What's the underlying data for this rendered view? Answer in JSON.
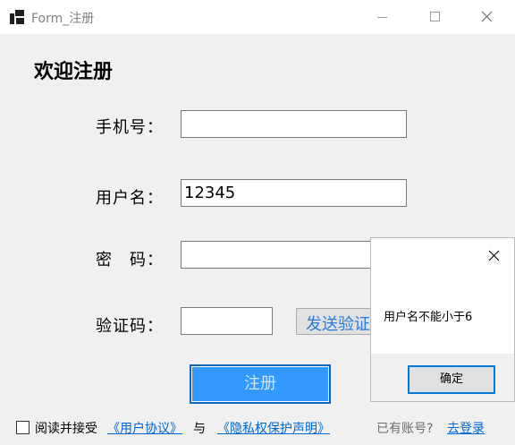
{
  "window": {
    "title": "Form_注册"
  },
  "heading": "欢迎注册",
  "form": {
    "phone_label": "手机号：",
    "phone_value": "",
    "username_label": "用户名：",
    "username_value": "12345",
    "password_label": "密　码：",
    "password_value": "",
    "code_label": "验证码：",
    "code_value": "",
    "send_code_label": "发送验证码",
    "register_label": "注册"
  },
  "footer": {
    "agree_text": "阅读并接受",
    "user_agreement": "《用户协议》",
    "and_text": "与",
    "privacy_policy": "《隐私权保护声明》",
    "have_account": "已有账号?",
    "login_link": "去登录"
  },
  "dialog": {
    "message": "用户名不能小于6",
    "ok_label": "确定"
  },
  "colors": {
    "primary_button": "#3399ff",
    "link": "#0066cc",
    "focus_border": "#0078d7"
  }
}
